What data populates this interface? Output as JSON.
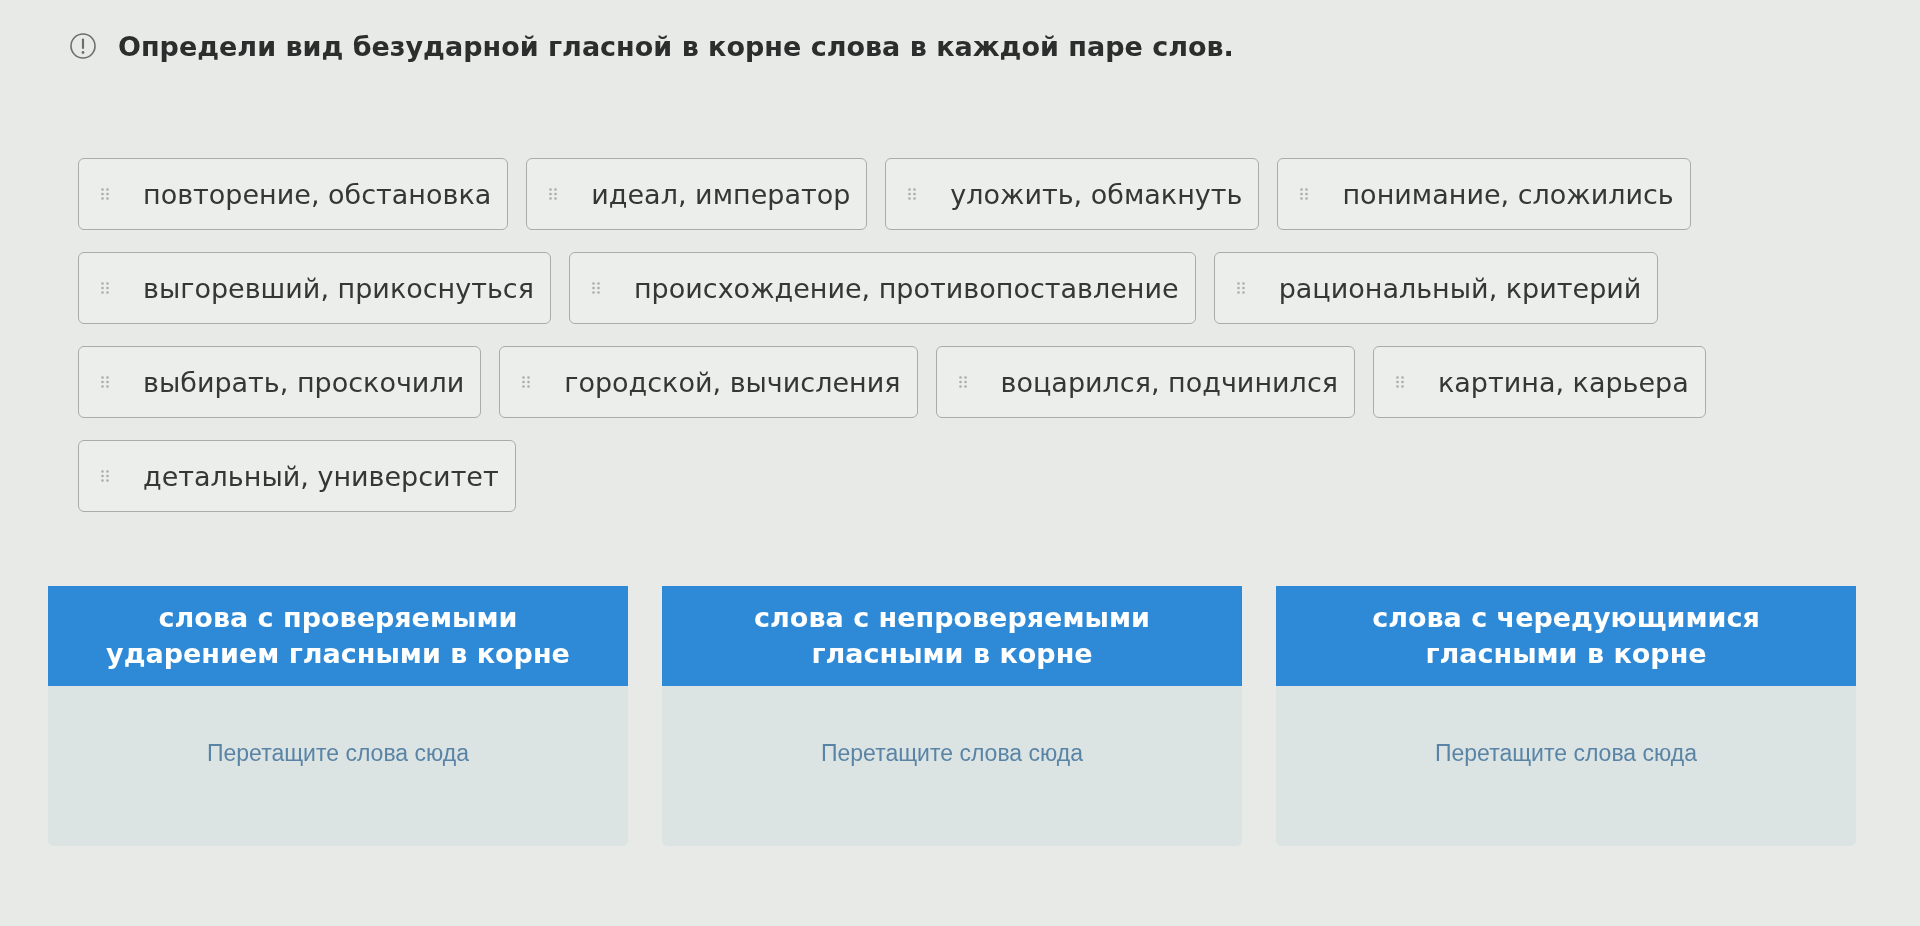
{
  "task": {
    "text": "Определи вид безударной гласной в корне слова в каждой паре слов."
  },
  "word_cards": [
    {
      "text": "повторение, обстановка"
    },
    {
      "text": "идеал, император"
    },
    {
      "text": "уложить, обмакнуть"
    },
    {
      "text": "понимание, сложились"
    },
    {
      "text": "выгоревший, прикоснуться"
    },
    {
      "text": "происхождение, противопоставление"
    },
    {
      "text": "рациональный, критерий"
    },
    {
      "text": "выбирать, проскочили"
    },
    {
      "text": "городской, вычисления"
    },
    {
      "text": "воцарился, подчинился"
    },
    {
      "text": "картина, карьера"
    },
    {
      "text": "детальный, университет"
    }
  ],
  "drop_zones": [
    {
      "title": "слова с проверяемыми ударением гласными в корне",
      "placeholder": "Перетащите слова сюда"
    },
    {
      "title": "слова с непроверяемыми гласными в корне",
      "placeholder": "Перетащите слова сюда"
    },
    {
      "title": "слова с чередующимися гласными в корне",
      "placeholder": "Перетащите слова сюда"
    }
  ]
}
